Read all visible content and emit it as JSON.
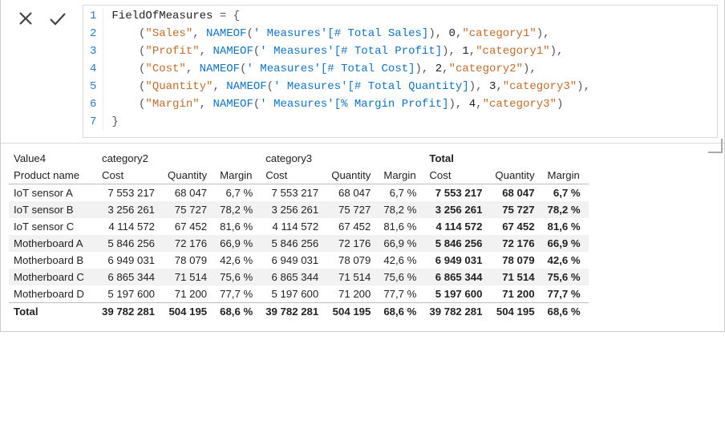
{
  "editor": {
    "varname": "FieldOfMeasures",
    "lines": [
      {
        "label": "Sales",
        "measure_ref": "' Measures'[# Total Sales]",
        "idx": 0,
        "cat": "category1"
      },
      {
        "label": "Profit",
        "measure_ref": "' Measures'[# Total Profit]",
        "idx": 1,
        "cat": "category1"
      },
      {
        "label": "Cost",
        "measure_ref": "' Measures'[# Total Cost]",
        "idx": 2,
        "cat": "category2"
      },
      {
        "label": "Quantity",
        "measure_ref": "' Measures'[# Total Quantity]",
        "idx": 3,
        "cat": "category3"
      },
      {
        "label": "Margin",
        "measure_ref": "' Measures'[% Margin Profit]",
        "idx": 4,
        "cat": "category3"
      }
    ],
    "func": "NAMEOF"
  },
  "matrix": {
    "filter_field_label": "Value4",
    "row_field_label": "Product name",
    "groups": [
      {
        "name": "category2",
        "cols": [
          "Cost",
          "Quantity",
          "Margin"
        ]
      },
      {
        "name": "category3",
        "cols": [
          "Cost",
          "Quantity",
          "Margin"
        ]
      },
      {
        "name": "Total",
        "cols": [
          "Cost",
          "Quantity",
          "Margin"
        ],
        "bold": true
      }
    ],
    "rows": [
      {
        "name": "IoT sensor A",
        "v": [
          "7 553 217",
          "68 047",
          "6,7 %",
          "7 553 217",
          "68 047",
          "6,7 %",
          "7 553 217",
          "68 047",
          "6,7 %"
        ]
      },
      {
        "name": "IoT sensor B",
        "v": [
          "3 256 261",
          "75 727",
          "78,2 %",
          "3 256 261",
          "75 727",
          "78,2 %",
          "3 256 261",
          "75 727",
          "78,2 %"
        ]
      },
      {
        "name": "IoT sensor C",
        "v": [
          "4 114 572",
          "67 452",
          "81,6 %",
          "4 114 572",
          "67 452",
          "81,6 %",
          "4 114 572",
          "67 452",
          "81,6 %"
        ]
      },
      {
        "name": "Motherboard A",
        "v": [
          "5 846 256",
          "72 176",
          "66,9 %",
          "5 846 256",
          "72 176",
          "66,9 %",
          "5 846 256",
          "72 176",
          "66,9 %"
        ]
      },
      {
        "name": "Motherboard B",
        "v": [
          "6 949 031",
          "78 079",
          "42,6 %",
          "6 949 031",
          "78 079",
          "42,6 %",
          "6 949 031",
          "78 079",
          "42,6 %"
        ]
      },
      {
        "name": "Motherboard C",
        "v": [
          "6 865 344",
          "71 514",
          "75,6 %",
          "6 865 344",
          "71 514",
          "75,6 %",
          "6 865 344",
          "71 514",
          "75,6 %"
        ]
      },
      {
        "name": "Motherboard D",
        "v": [
          "5 197 600",
          "71 200",
          "77,7 %",
          "5 197 600",
          "71 200",
          "77,7 %",
          "5 197 600",
          "71 200",
          "77,7 %"
        ]
      }
    ],
    "total_label": "Total",
    "total": [
      "39 782 281",
      "504 195",
      "68,6 %",
      "39 782 281",
      "504 195",
      "68,6 %",
      "39 782 281",
      "504 195",
      "68,6 %"
    ]
  }
}
